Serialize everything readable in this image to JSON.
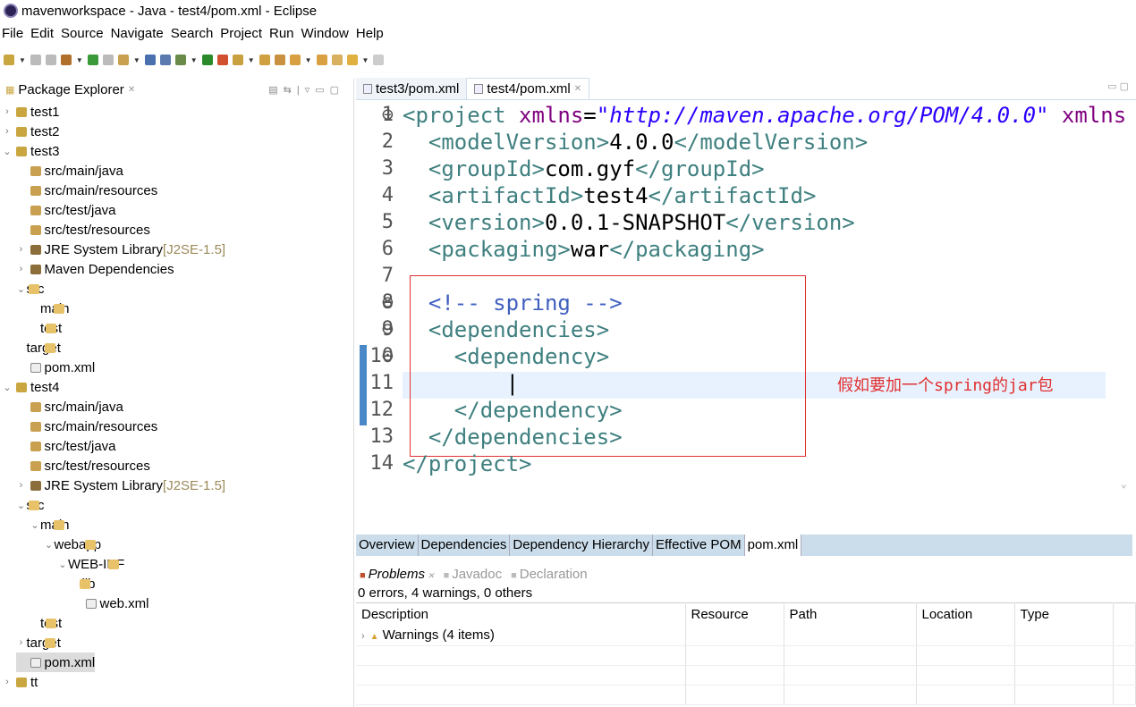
{
  "window": {
    "title": "mavenworkspace - Java - test4/pom.xml - Eclipse"
  },
  "menu": [
    "File",
    "Edit",
    "Source",
    "Navigate",
    "Search",
    "Project",
    "Run",
    "Window",
    "Help"
  ],
  "explorer": {
    "title": "Package Explorer",
    "items": [
      {
        "label": "test1",
        "level": 0,
        "arrow": "›",
        "icon": "proj"
      },
      {
        "label": "test2",
        "level": 0,
        "arrow": "›",
        "icon": "proj"
      },
      {
        "label": "test3",
        "level": 0,
        "arrow": "⌄",
        "icon": "proj"
      },
      {
        "label": "src/main/java",
        "level": 1,
        "arrow": "",
        "icon": "pkg"
      },
      {
        "label": "src/main/resources",
        "level": 1,
        "arrow": "",
        "icon": "pkg"
      },
      {
        "label": "src/test/java",
        "level": 1,
        "arrow": "",
        "icon": "pkg"
      },
      {
        "label": "src/test/resources",
        "level": 1,
        "arrow": "",
        "icon": "pkg"
      },
      {
        "label": "JRE System Library",
        "decoration": "[J2SE-1.5]",
        "level": 1,
        "arrow": "›",
        "icon": "lib"
      },
      {
        "label": "Maven Dependencies",
        "level": 1,
        "arrow": "›",
        "icon": "lib"
      },
      {
        "label": "src",
        "level": 1,
        "arrow": "⌄",
        "icon": "fold"
      },
      {
        "label": "main",
        "level": 2,
        "arrow": "",
        "icon": "fold"
      },
      {
        "label": "test",
        "level": 2,
        "arrow": "",
        "icon": "fold"
      },
      {
        "label": "target",
        "level": 1,
        "arrow": "",
        "icon": "fold"
      },
      {
        "label": "pom.xml",
        "level": 1,
        "arrow": "",
        "icon": "file"
      },
      {
        "label": "test4",
        "level": 0,
        "arrow": "⌄",
        "icon": "proj"
      },
      {
        "label": "src/main/java",
        "level": 1,
        "arrow": "",
        "icon": "pkg"
      },
      {
        "label": "src/main/resources",
        "level": 1,
        "arrow": "",
        "icon": "pkg"
      },
      {
        "label": "src/test/java",
        "level": 1,
        "arrow": "",
        "icon": "pkg"
      },
      {
        "label": "src/test/resources",
        "level": 1,
        "arrow": "",
        "icon": "pkg"
      },
      {
        "label": "JRE System Library",
        "decoration": "[J2SE-1.5]",
        "level": 1,
        "arrow": "›",
        "icon": "lib"
      },
      {
        "label": "src",
        "level": 1,
        "arrow": "⌄",
        "icon": "fold"
      },
      {
        "label": "main",
        "level": 2,
        "arrow": "⌄",
        "icon": "fold"
      },
      {
        "label": "webapp",
        "level": 3,
        "arrow": "⌄",
        "icon": "fold"
      },
      {
        "label": "WEB-INF",
        "level": 4,
        "arrow": "⌄",
        "icon": "fold"
      },
      {
        "label": "lib",
        "level": 5,
        "arrow": "",
        "icon": "fold"
      },
      {
        "label": "web.xml",
        "level": 5,
        "arrow": "",
        "icon": "file"
      },
      {
        "label": "test",
        "level": 2,
        "arrow": "",
        "icon": "fold"
      },
      {
        "label": "target",
        "level": 1,
        "arrow": "›",
        "icon": "fold"
      },
      {
        "label": "pom.xml",
        "level": 1,
        "arrow": "",
        "icon": "file",
        "selected": true
      },
      {
        "label": "tt",
        "level": 0,
        "arrow": "›",
        "icon": "proj"
      }
    ]
  },
  "editor": {
    "tabs": [
      {
        "label": "test3/pom.xml",
        "active": false
      },
      {
        "label": "test4/pom.xml",
        "active": true
      }
    ],
    "lines": [
      [
        [
          "t",
          "<project "
        ],
        [
          "a",
          "xmlns"
        ],
        [
          "",
          "="
        ],
        [
          "s",
          "\"http://maven.apache.org/POM/4.0.0\""
        ],
        [
          "a",
          " xmlns"
        ]
      ],
      [
        [
          "t",
          "  <modelVersion>"
        ],
        [
          "",
          "4.0.0"
        ],
        [
          "t",
          "</modelVersion>"
        ]
      ],
      [
        [
          "t",
          "  <groupId>"
        ],
        [
          "",
          "com.gyf"
        ],
        [
          "t",
          "</groupId>"
        ]
      ],
      [
        [
          "t",
          "  <artifactId>"
        ],
        [
          "",
          "test4"
        ],
        [
          "t",
          "</artifactId>"
        ]
      ],
      [
        [
          "t",
          "  <version>"
        ],
        [
          "",
          "0.0.1-SNAPSHOT"
        ],
        [
          "t",
          "</version>"
        ]
      ],
      [
        [
          "t",
          "  <packaging>"
        ],
        [
          "",
          "war"
        ],
        [
          "t",
          "</packaging>"
        ]
      ],
      [],
      [
        [
          "c",
          "  <!-- spring -->"
        ]
      ],
      [
        [
          "t",
          "  <dependencies>"
        ]
      ],
      [
        [
          "t",
          "    <dependency>"
        ]
      ],
      [
        [
          "",
          "        |"
        ]
      ],
      [
        [
          "t",
          "    </dependency>"
        ]
      ],
      [
        [
          "t",
          "  </dependencies>"
        ]
      ],
      [
        [
          "t",
          "</project>"
        ]
      ]
    ],
    "folded_lines": [
      1,
      8,
      9,
      10
    ],
    "current_line": 11,
    "annotation": "假如要加一个spring的jar包",
    "bottom_tabs": [
      "Overview",
      "Dependencies",
      "Dependency Hierarchy",
      "Effective POM",
      "pom.xml"
    ],
    "active_bottom_tab": "pom.xml"
  },
  "problems": {
    "tabs": [
      "Problems",
      "Javadoc",
      "Declaration"
    ],
    "summary": "0 errors, 4 warnings, 0 others",
    "columns": [
      "Description",
      "Resource",
      "Path",
      "Location",
      "Type"
    ],
    "rows": [
      {
        "description": "Warnings (4 items)"
      }
    ]
  },
  "colors": {
    "annotation": "#e03030",
    "current_line": "#e8f2fe",
    "tag": "#3f7f7f",
    "string": "#2a00ff",
    "attr": "#7f007f",
    "comment": "#3f5fbf"
  }
}
